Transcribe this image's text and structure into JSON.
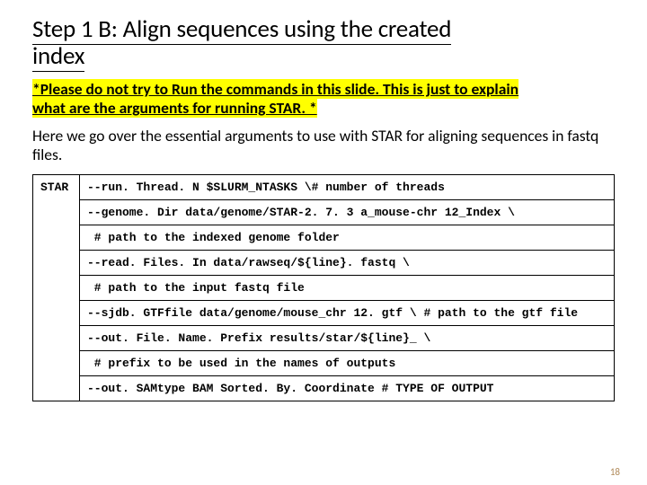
{
  "title_line1": "Step 1 B: Align sequences using the created",
  "title_line2": "index",
  "disclaimer_line1": "*Please do not try to Run the commands in this slide. This is just to explain",
  "disclaimer_line2": "what are the arguments for running STAR. *",
  "intro": "Here we go over the essential arguments to use with STAR for aligning sequences in fastq files.",
  "code": {
    "left": "STAR",
    "lines": [
      "--run. Thread. N $SLURM_NTASKS \\# number of threads",
      "--genome. Dir data/genome/STAR-2. 7. 3 a_mouse-chr 12_Index \\",
      " # path to the indexed genome folder",
      "--read. Files. In data/rawseq/${line}. fastq \\",
      " # path to the input fastq file",
      "--sjdb. GTFfile data/genome/mouse_chr 12. gtf \\ # path to the gtf file",
      "--out. File. Name. Prefix results/star/${line}_ \\",
      " # prefix to be used in the names of outputs",
      "--out. SAMtype BAM Sorted. By. Coordinate # TYPE OF OUTPUT"
    ]
  },
  "page_num": "18"
}
